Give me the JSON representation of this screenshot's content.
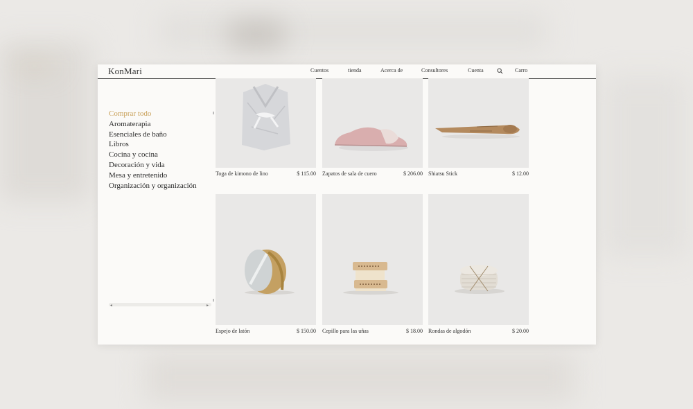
{
  "brand": {
    "logo": "KonMari"
  },
  "nav": {
    "items": [
      "Cuentos",
      "tienda",
      "Acerca de",
      "Consultores",
      "Cuenta"
    ],
    "cart": "Carro"
  },
  "sidebar": {
    "categories": [
      "Comprar todo",
      "Aromaterapia",
      "Esenciales de baño",
      "Libros",
      "Cocina y cocina",
      "Decoración y vida",
      "Mesa y entretenido",
      "Organización y organización"
    ],
    "active_index": 0
  },
  "products": [
    {
      "name": "Toga de kimono de lino",
      "price": "$ 115.00"
    },
    {
      "name": "Zapatos de sala de cuero",
      "price": "$ 206.00"
    },
    {
      "name": "Shiatsu Stick",
      "price": "$ 12.00"
    },
    {
      "name": "Espejo de latón",
      "price": "$ 150.00"
    },
    {
      "name": "Cepillo para las uñas",
      "price": "$ 18.00"
    },
    {
      "name": "Rondas de algodón",
      "price": "$ 20.00"
    }
  ],
  "colors": {
    "accent": "#c9a15a",
    "text": "#2a2a2a",
    "card_bg": "#e9e8e7"
  },
  "icons": {
    "search": "search-icon"
  }
}
